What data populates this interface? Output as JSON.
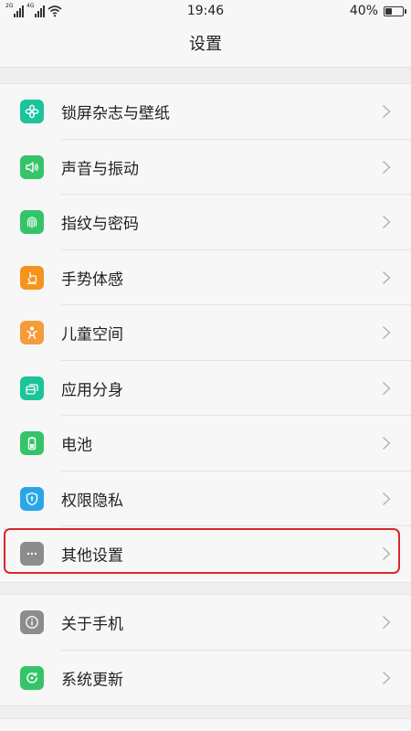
{
  "status_bar": {
    "network_1": "2G",
    "network_2": "4G",
    "time": "19:46",
    "battery": "40%",
    "battery_level": 0.4
  },
  "title": "设置",
  "group_1": [
    {
      "label": "锁屏杂志与壁纸",
      "icon": "flower-icon",
      "color": "#1cc49a"
    },
    {
      "label": "声音与振动",
      "icon": "speaker-icon",
      "color": "#35c46a"
    },
    {
      "label": "指纹与密码",
      "icon": "fingerprint-icon",
      "color": "#35c46a"
    },
    {
      "label": "手势体感",
      "icon": "hand-gesture-icon",
      "color": "#f5941d"
    },
    {
      "label": "儿童空间",
      "icon": "child-icon",
      "color": "#f59b3a"
    },
    {
      "label": "应用分身",
      "icon": "app-clone-icon",
      "color": "#1cc49a"
    },
    {
      "label": "电池",
      "icon": "battery-icon",
      "color": "#35c46a"
    },
    {
      "label": "权限隐私",
      "icon": "shield-icon",
      "color": "#2aa6e8"
    },
    {
      "label": "其他设置",
      "icon": "more-dots-icon",
      "color": "#8c8c8c"
    }
  ],
  "group_2": [
    {
      "label": "关于手机",
      "icon": "info-icon",
      "color": "#8c8c8c"
    },
    {
      "label": "系统更新",
      "icon": "update-icon",
      "color": "#35c46a"
    }
  ]
}
